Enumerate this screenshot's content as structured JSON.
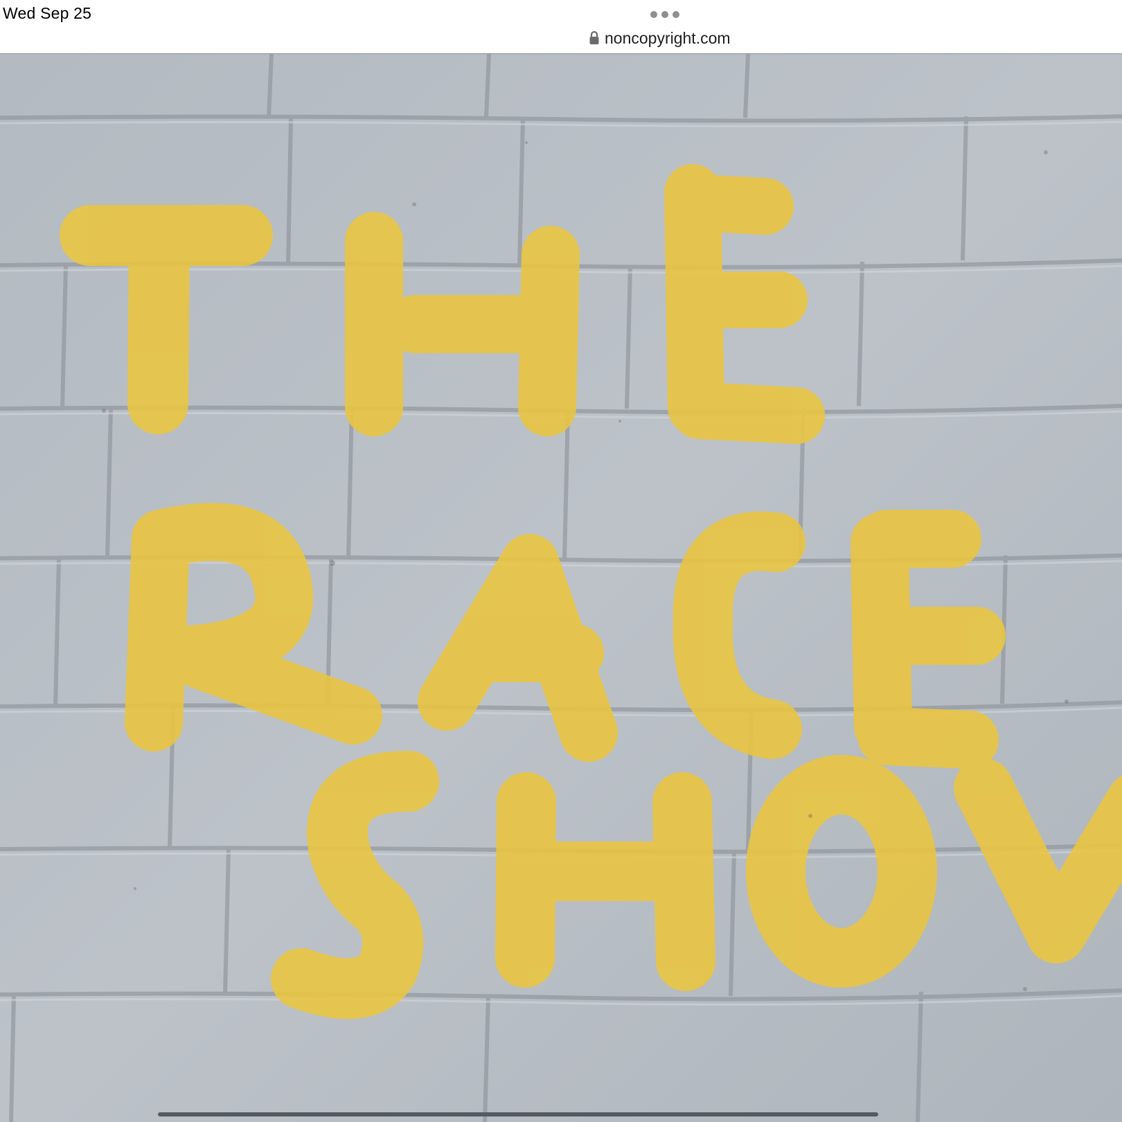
{
  "status_bar": {
    "date": "Wed Sep 25"
  },
  "browser": {
    "url": "noncopyright.com",
    "menu_icon": "more-dots-icon",
    "lock_icon": "lock-icon"
  },
  "artwork": {
    "lines": [
      "THE",
      "RACE",
      "SHOW"
    ],
    "paint_color": "#e9c543",
    "wall_color": "#b5bcc3",
    "mortar_color": "#8f959b"
  }
}
